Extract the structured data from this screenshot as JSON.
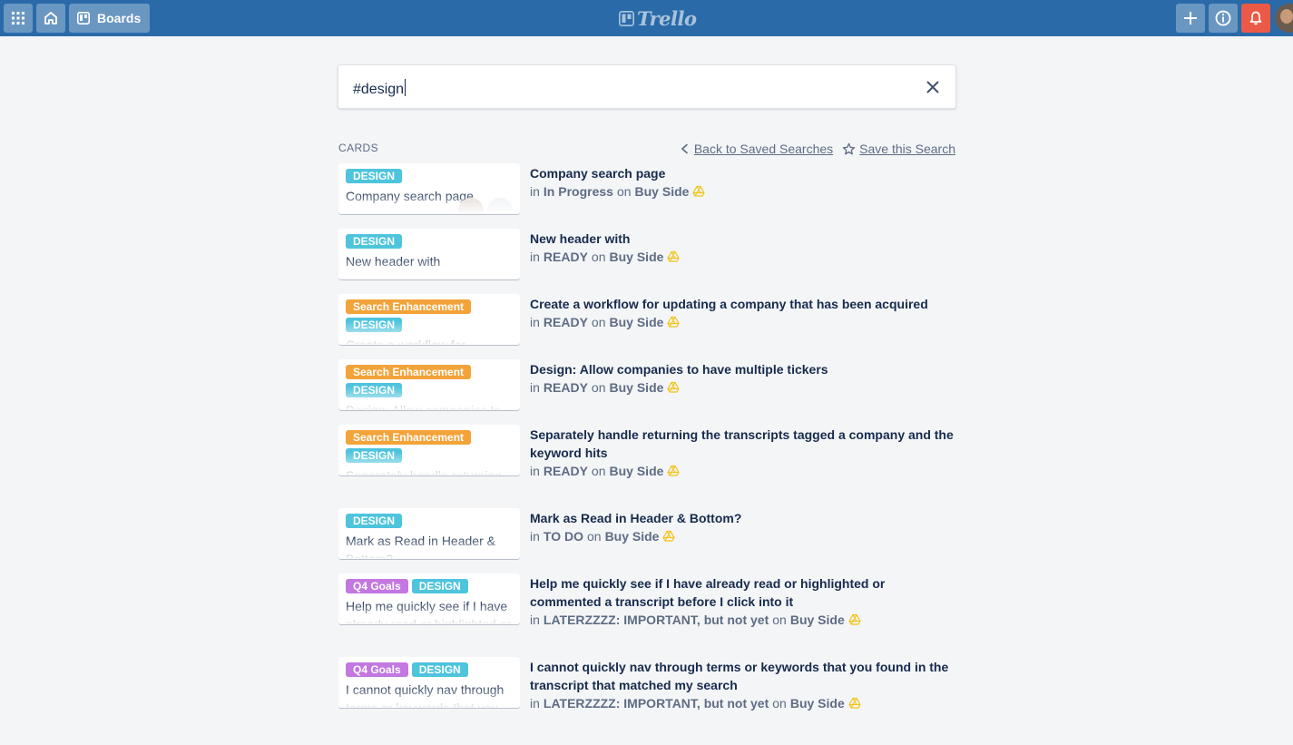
{
  "header": {
    "boards_label": "Boards",
    "logo_text": "Trello",
    "icons": [
      "apps-icon",
      "home-icon",
      "boards-icon",
      "add-icon",
      "info-icon",
      "bell-icon",
      "avatar"
    ],
    "colors": {
      "bar": "#2a6aa8",
      "bell": "#eb5a46"
    }
  },
  "search": {
    "value": "#design"
  },
  "section": {
    "heading": "CARDS",
    "back_label": "Back to Saved Searches",
    "save_label": "Save this Search"
  },
  "results": [
    {
      "labels": [
        {
          "text": "DESIGN",
          "kind": "design"
        }
      ],
      "card_title": "Company search page",
      "title": "Company search page",
      "list": "In Progress",
      "board": "Buy Side",
      "has_avatars": true
    },
    {
      "labels": [
        {
          "text": "DESIGN",
          "kind": "design"
        }
      ],
      "card_title": "New header with",
      "title": "New header with",
      "list": "READY",
      "board": "Buy Side"
    },
    {
      "labels": [
        {
          "text": "Search Enhancement",
          "kind": "search"
        },
        {
          "text": "DESIGN",
          "kind": "design"
        }
      ],
      "card_title": "Create a workflow for",
      "title": "Create a workflow for updating a company that has been acquired",
      "list": "READY",
      "board": "Buy Side"
    },
    {
      "labels": [
        {
          "text": "Search Enhancement",
          "kind": "search"
        },
        {
          "text": "DESIGN",
          "kind": "design"
        }
      ],
      "card_title": "Design: Allow companies to",
      "title": "Design: Allow companies to have multiple tickers",
      "list": "READY",
      "board": "Buy Side"
    },
    {
      "labels": [
        {
          "text": "Search Enhancement",
          "kind": "search"
        },
        {
          "text": "DESIGN",
          "kind": "design"
        }
      ],
      "card_title": "Separately handle returning the transcripts tagged a",
      "title": "Separately handle returning the transcripts tagged a company and the keyword hits",
      "list": "READY",
      "board": "Buy Side"
    },
    {
      "labels": [
        {
          "text": "DESIGN",
          "kind": "design"
        }
      ],
      "card_title": "Mark as Read in Header & Bottom?",
      "title": "Mark as Read in Header & Bottom?",
      "list": "TO DO",
      "board": "Buy Side"
    },
    {
      "labels": [
        {
          "text": "Q4 Goals",
          "kind": "q4"
        },
        {
          "text": "DESIGN",
          "kind": "design"
        }
      ],
      "card_title": "Help me quickly see if I have already read or highlighted or commented a transcript",
      "title": "Help me quickly see if I have already read or highlighted or commented a transcript before I click into it",
      "list": "LATERZZZZ: IMPORTANT, but not yet",
      "board": "Buy Side"
    },
    {
      "labels": [
        {
          "text": "Q4 Goals",
          "kind": "q4"
        },
        {
          "text": "DESIGN",
          "kind": "design"
        }
      ],
      "card_title": "I cannot quickly nav through terms or keywords that you found in the transcript that",
      "title": "I cannot quickly nav through terms or keywords that you found in the transcript that matched my search",
      "list": "LATERZZZZ: IMPORTANT, but not yet",
      "board": "Buy Side"
    }
  ],
  "meta_words": {
    "in": "in",
    "on": "on"
  }
}
